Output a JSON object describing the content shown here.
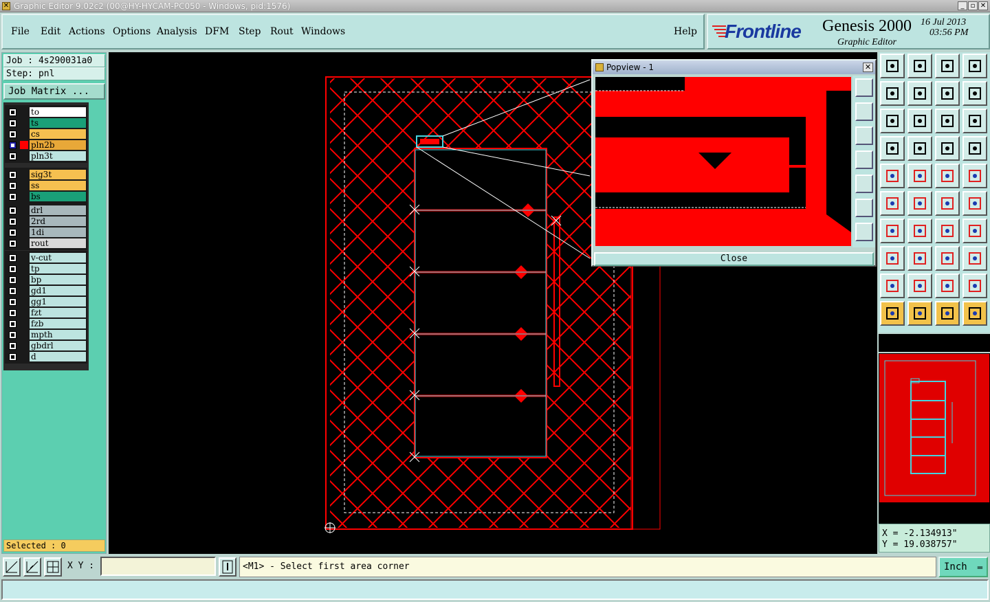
{
  "window": {
    "title": "Graphic Editor 9.02c2 (00@HY-HYCAM-PC050 - Windows, pid:1576)"
  },
  "menu": {
    "items": [
      "File",
      "Edit",
      "Actions",
      "Options",
      "Analysis",
      "DFM",
      "Step",
      "Rout",
      "Windows"
    ],
    "help": "Help"
  },
  "brand": {
    "logo": "Frontline",
    "product": "Genesis 2000",
    "subtitle": "Graphic Editor",
    "date": "16 Jul 2013",
    "time": "03:56 PM"
  },
  "job": {
    "job_label": "Job : 4s290031a0",
    "step_label": "Step: pnl",
    "matrix_button": "Job Matrix ..."
  },
  "layers": {
    "group1": [
      {
        "name": "to",
        "color": "#ffffff"
      },
      {
        "name": "ts",
        "color": "#1aa078"
      },
      {
        "name": "cs",
        "color": "#f5c050"
      },
      {
        "name": "pln2b",
        "color": "#e8a838",
        "active": true
      },
      {
        "name": "pln3t",
        "color": "#bde4e0"
      }
    ],
    "group2": [
      {
        "name": "sig3t",
        "color": "#f5c050"
      },
      {
        "name": "ss",
        "color": "#f5c050"
      },
      {
        "name": "bs",
        "color": "#1aa078"
      }
    ],
    "group3": [
      {
        "name": "drl",
        "color": "#a8b8bc"
      },
      {
        "name": "2rd",
        "color": "#a8b8bc"
      },
      {
        "name": "1di",
        "color": "#a8b8bc"
      },
      {
        "name": "rout",
        "color": "#d8d8d8"
      }
    ],
    "group4": [
      {
        "name": "v-cut",
        "color": "#bde4e0"
      },
      {
        "name": "tp",
        "color": "#bde4e0"
      },
      {
        "name": "bp",
        "color": "#bde4e0"
      },
      {
        "name": "gd1",
        "color": "#bde4e0"
      },
      {
        "name": "gg1",
        "color": "#bde4e0"
      },
      {
        "name": "fzt",
        "color": "#bde4e0"
      },
      {
        "name": "fzb",
        "color": "#bde4e0"
      },
      {
        "name": "mpth",
        "color": "#bde4e0"
      },
      {
        "name": "gbdrl",
        "color": "#bde4e0"
      },
      {
        "name": "d",
        "color": "#bde4e0"
      }
    ]
  },
  "selection": {
    "label": "Selected : 0"
  },
  "popview": {
    "title": "Popview - 1",
    "close_label": "Close"
  },
  "coords": {
    "x": "X = -2.134913\"",
    "y": "Y = 19.038757\""
  },
  "bottom": {
    "xy_label": "X Y :",
    "xy_value": "",
    "prompt": "<M1> - Select first area corner",
    "unit": "Inch"
  },
  "colors": {
    "feature": "#ff0000",
    "profile": "#44d4e0",
    "panel": "#5ccfb0",
    "background": "#000000"
  }
}
